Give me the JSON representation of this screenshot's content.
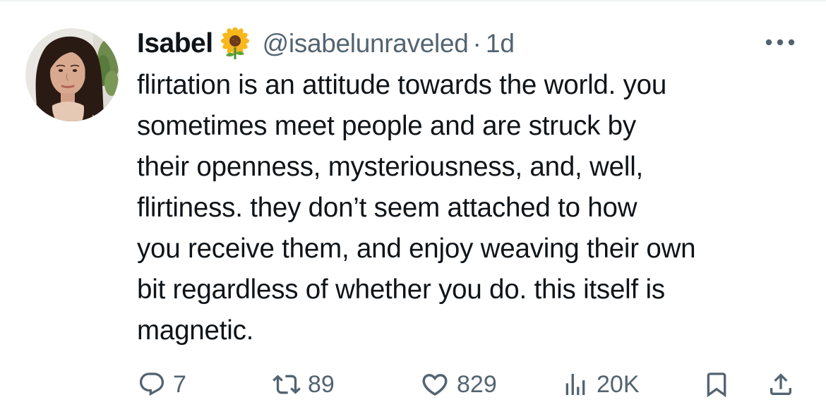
{
  "tweet": {
    "display_name": "Isabel",
    "name_emoji": "sunflower-icon",
    "handle": "@isabelunraveled",
    "separator": "·",
    "time": "1d",
    "text": "flirtation is an attitude towards the world. you\nsometimes meet people and are struck by\ntheir openness, mysteriousness, and, well,\nflirtiness. they don’t seem attached to how\nyou receive them, and enjoy weaving their own\nbit regardless of whether you do. this itself is\nmagnetic."
  },
  "actions": {
    "replies": "7",
    "reposts": "89",
    "likes": "829",
    "views": "20K"
  },
  "colors": {
    "text": "#0f1419",
    "secondary": "#536471",
    "divider": "#eff3f4"
  }
}
